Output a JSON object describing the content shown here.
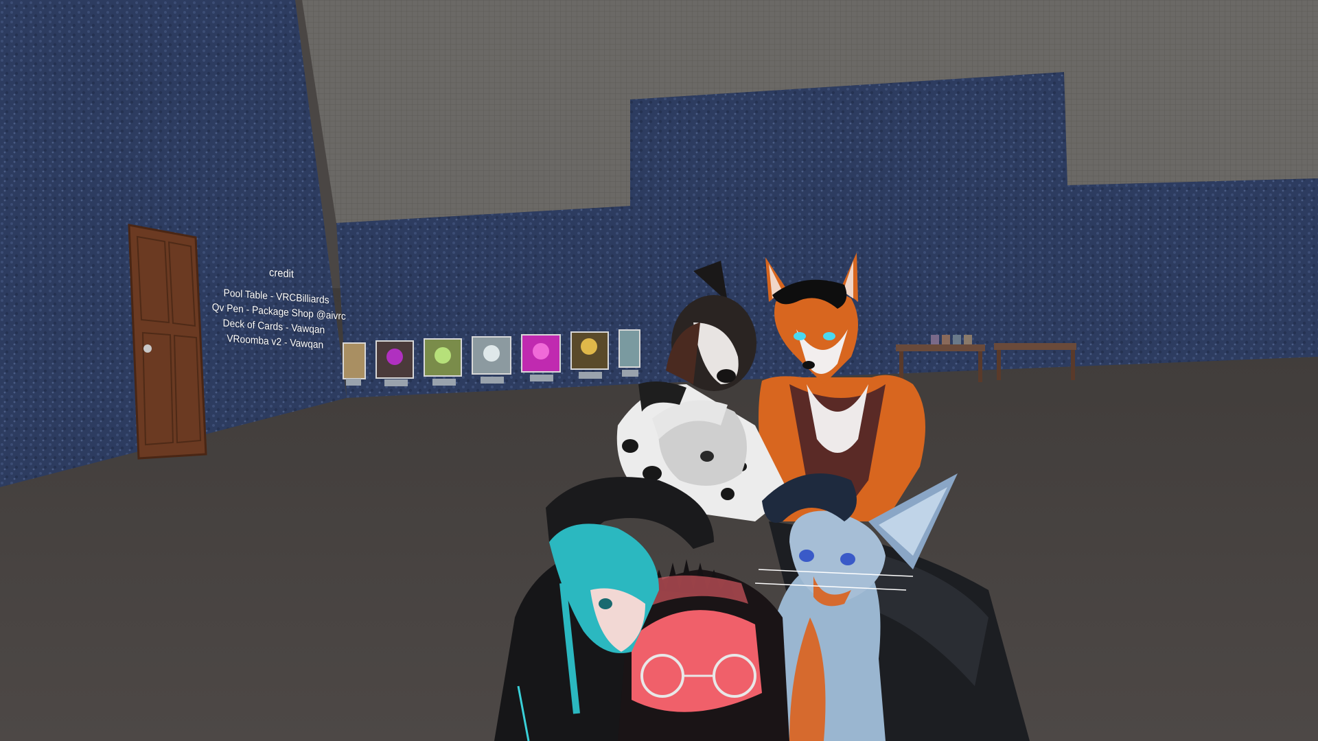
{
  "scene": {
    "world": "VRChat room",
    "colors": {
      "wall": "#2b3a5e",
      "floor": "#4a4644",
      "ceiling": "#6d6b68",
      "door": "#6b3a22"
    }
  },
  "credit_board": {
    "title": "credit",
    "lines": [
      "Pool Table - VRCBilliards",
      "Qv Pen - Package Shop @aivrc",
      "Deck of Cards - Vawqan",
      "VRoomba v2 - Vawqan"
    ]
  },
  "avatar_pedestals": {
    "count": 7
  },
  "avatars": [
    "spotted-dog-avatar",
    "fox-avatar",
    "white-hair-dalmatian-avatar",
    "teal-hair-avatar",
    "blue-fennec-cat-avatar",
    "red-spiky-avatar-with-glasses",
    "dark-horse-avatar"
  ]
}
